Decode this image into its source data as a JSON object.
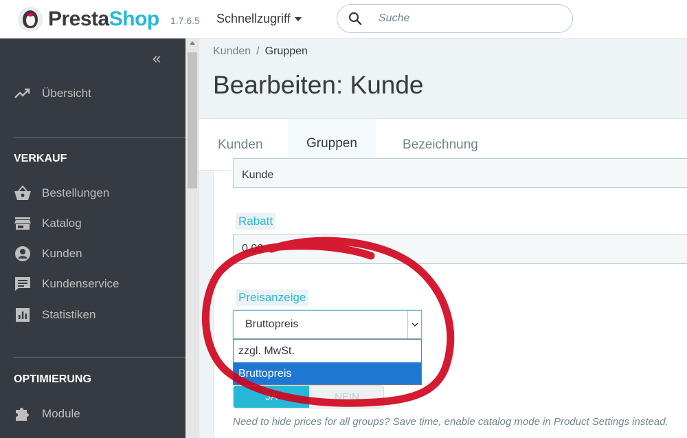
{
  "header": {
    "brand_part1": "Presta",
    "brand_part2": "Shop",
    "version": "1.7.6.5",
    "quick_access": "Schnellzugriff",
    "search_placeholder": "Suche"
  },
  "sidebar": {
    "items": [
      {
        "label": "Übersicht",
        "icon": "trending-up-icon"
      },
      {
        "label": "Bestellungen",
        "icon": "basket-icon"
      },
      {
        "label": "Katalog",
        "icon": "store-icon"
      },
      {
        "label": "Kunden",
        "icon": "account-circle-icon"
      },
      {
        "label": "Kundenservice",
        "icon": "chat-icon"
      },
      {
        "label": "Statistiken",
        "icon": "bar-chart-icon"
      },
      {
        "label": "Module",
        "icon": "puzzle-icon"
      }
    ],
    "sections": {
      "sales": "VERKAUF",
      "optimize": "OPTIMIERUNG"
    }
  },
  "breadcrumb": {
    "parent": "Kunden",
    "separator": "/",
    "current": "Gruppen"
  },
  "page_title": "Bearbeiten: Kunde",
  "tabs": [
    {
      "label": "Kunden",
      "active": false
    },
    {
      "label": "Gruppen",
      "active": true
    },
    {
      "label": "Bezeichnung",
      "active": false
    }
  ],
  "form": {
    "name_value": "Kunde",
    "discount_label": "Rabatt",
    "discount_value": "0.00",
    "price_display_label": "Preisanzeige",
    "price_display_selected": "Bruttopreis",
    "price_display_options": [
      "zzgl. MwSt.",
      "Bruttopreis"
    ],
    "toggle_yes": "JA",
    "toggle_no": "NEIN",
    "help_text": "Need to hide prices for all groups? Save time, enable catalog mode in Product Settings instead."
  },
  "colors": {
    "accent": "#25b9d7",
    "sidebar_bg": "#363a41",
    "annotation": "#d0021b",
    "selected_option": "#1e78d2"
  }
}
